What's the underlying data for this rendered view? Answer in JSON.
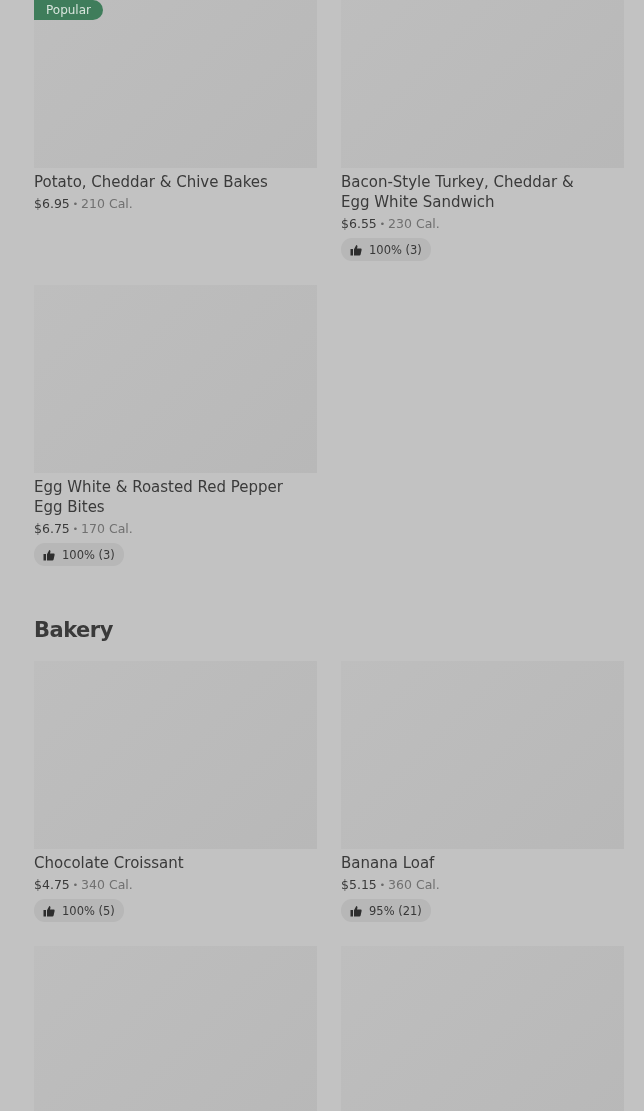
{
  "sections": [
    {
      "items": [
        {
          "kind": "item",
          "badge": "Popular",
          "name": "Potato, Cheddar & Chive Bakes",
          "price": "$6.95",
          "separator": "•",
          "calories": "210 Cal."
        },
        {
          "kind": "item",
          "name": "Bacon-Style Turkey, Cheddar & Egg White Sandwich",
          "price": "$6.55",
          "separator": "•",
          "calories": "230 Cal.",
          "rating": "100% (3)"
        },
        {
          "kind": "item",
          "name": "Egg White & Roasted Red Pepper Egg Bites",
          "price": "$6.75",
          "separator": "•",
          "calories": "170 Cal.",
          "rating": "100% (3)"
        }
      ]
    },
    {
      "title": "Bakery",
      "items": [
        {
          "kind": "item",
          "name": "Chocolate Croissant",
          "price": "$4.75",
          "separator": "•",
          "calories": "340 Cal.",
          "rating": "100% (5)"
        },
        {
          "kind": "item",
          "name": "Banana Loaf",
          "price": "$5.15",
          "separator": "•",
          "calories": "360 Cal.",
          "rating": "95% (21)"
        },
        {
          "kind": "picture"
        },
        {
          "kind": "picture"
        }
      ]
    }
  ]
}
